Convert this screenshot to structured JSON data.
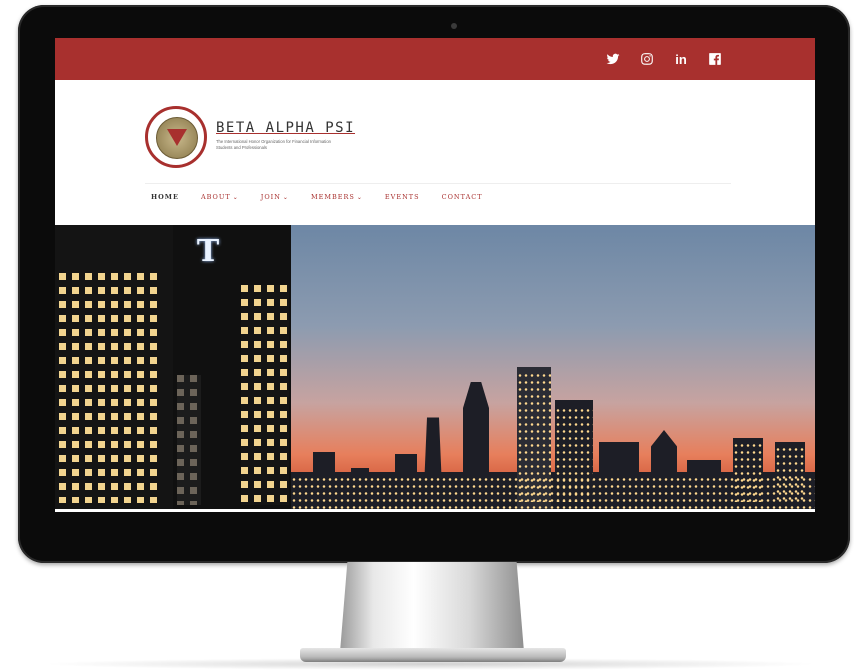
{
  "social": {
    "icons": [
      "twitter-icon",
      "instagram-icon",
      "linkedin-icon",
      "facebook-icon"
    ],
    "linkedin_label": "in"
  },
  "brand": {
    "name": "BETA ALPHA PSI",
    "tagline": "The International Honor Organization for Financial Information Students and Professionals"
  },
  "nav": {
    "items": [
      {
        "label": "Home",
        "active": true
      },
      {
        "label": "About",
        "dropdown": true
      },
      {
        "label": "Join",
        "dropdown": true
      },
      {
        "label": "Members",
        "dropdown": true
      },
      {
        "label": "Events"
      },
      {
        "label": "Contact"
      }
    ]
  },
  "hero": {
    "sign_letter": "T"
  },
  "colors": {
    "brand_red": "#a8302e",
    "nav_text": "#a8302e",
    "nav_active": "#333333"
  }
}
